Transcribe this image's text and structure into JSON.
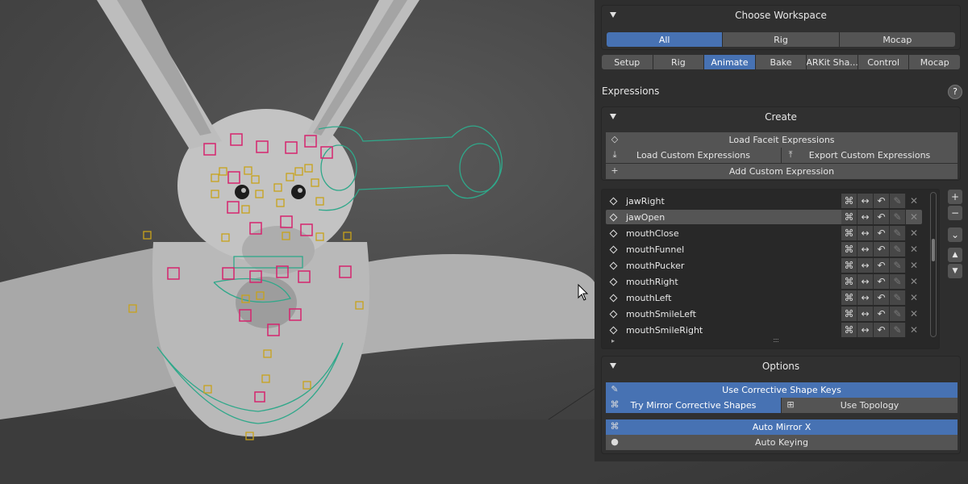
{
  "workspace": {
    "title": "Choose Workspace",
    "options": [
      "All",
      "Rig",
      "Mocap"
    ],
    "selected": "All"
  },
  "tabs": {
    "items": [
      "Setup",
      "Rig",
      "Animate",
      "Bake",
      "ARKit Sha...",
      "Control",
      "Mocap"
    ],
    "active": "Animate"
  },
  "expressions": {
    "label": "Expressions",
    "help_icon": "?"
  },
  "create": {
    "title": "Create",
    "load_faceit": "Load Faceit Expressions",
    "load_custom": "Load Custom Expressions",
    "export_custom": "Export Custom Expressions",
    "add_custom": "Add Custom Expression"
  },
  "expression_list": {
    "selected": "jawOpen",
    "items": [
      "jawRight",
      "jawOpen",
      "mouthClose",
      "mouthFunnel",
      "mouthPucker",
      "mouthRight",
      "mouthLeft",
      "mouthSmileLeft",
      "mouthSmileRight"
    ],
    "resize_handle": "::::",
    "expand_arrow": "▸"
  },
  "list_side_buttons": {
    "add": "+",
    "remove": "−",
    "menu": "⌄",
    "move_up": "▲",
    "move_down": "▼"
  },
  "options": {
    "title": "Options",
    "use_corrective": "Use Corrective Shape Keys",
    "try_mirror": "Try Mirror Corrective Shapes",
    "use_topology": "Use Topology",
    "auto_mirror": "Auto Mirror X",
    "auto_keying": "Auto Keying"
  },
  "colors": {
    "accent": "#4772b3",
    "panel": "#303030",
    "button": "#545454",
    "control_magenta": "#d6246e",
    "control_yellow": "#c8a21a",
    "control_teal": "#2fa88a"
  }
}
